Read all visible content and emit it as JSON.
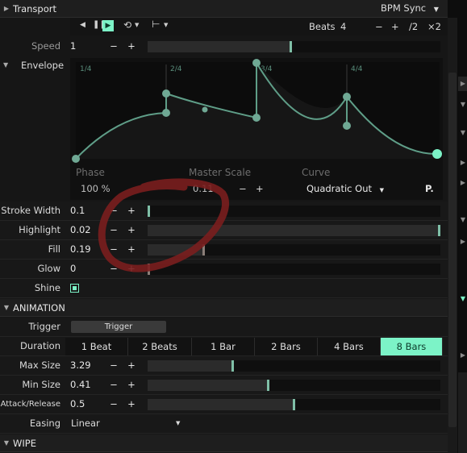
{
  "header": {
    "title": "Transport",
    "bpm_sync": "BPM Sync"
  },
  "transport": {
    "beats_label": "Beats",
    "beats_value": "4",
    "minus": "−",
    "plus": "+",
    "half": "/2",
    "double": "×2"
  },
  "speed": {
    "label": "Speed",
    "value": "1",
    "level": 0.49
  },
  "envelope": {
    "label": "Envelope",
    "markers": [
      "1/4",
      "2/4",
      "3/4",
      "4/4"
    ],
    "phase_label": "Phase",
    "phase_value": "100 %",
    "scale_label": "Master Scale",
    "scale_value": "0.11",
    "curve_label": "Curve",
    "curve_value": "Quadratic Out",
    "p_button": "P."
  },
  "params": [
    {
      "label": "Stroke Width",
      "value": "0.1",
      "level": 0.0,
      "thumb": "green"
    },
    {
      "label": "Highlight",
      "value": "0.02",
      "level": 1.0,
      "thumb": "green"
    },
    {
      "label": "Fill",
      "value": "0.19",
      "level": 0.19,
      "thumb": "gray"
    },
    {
      "label": "Glow",
      "value": "0",
      "level": 0.0,
      "thumb": "gray"
    }
  ],
  "shine": {
    "label": "Shine",
    "checked": true
  },
  "animation": {
    "title": "ANIMATION",
    "trigger_label": "Trigger",
    "trigger_button": "Trigger",
    "duration_label": "Duration",
    "durations": [
      "1 Beat",
      "2 Beats",
      "1 Bar",
      "2 Bars",
      "4 Bars",
      "8 Bars"
    ],
    "active_duration": "8 Bars",
    "sliders": [
      {
        "label": "Max Size",
        "value": "3.29",
        "level": 0.29
      },
      {
        "label": "Min Size",
        "value": "0.41",
        "level": 0.41
      },
      {
        "label": "Attack/Release",
        "value": "0.5",
        "level": 0.5
      }
    ],
    "easing_label": "Easing",
    "easing_value": "Linear"
  },
  "wipe": {
    "title": "WIPE"
  },
  "colors": {
    "accent": "#7cf3c7",
    "curve": "#7fbfa7",
    "annotation": "#7a1e1e"
  },
  "icons": [
    "chevron-right-icon",
    "chevron-down-icon",
    "step-back-icon",
    "pause-icon",
    "play-icon",
    "loop-icon",
    "marker-icon",
    "checkbox-icon"
  ]
}
